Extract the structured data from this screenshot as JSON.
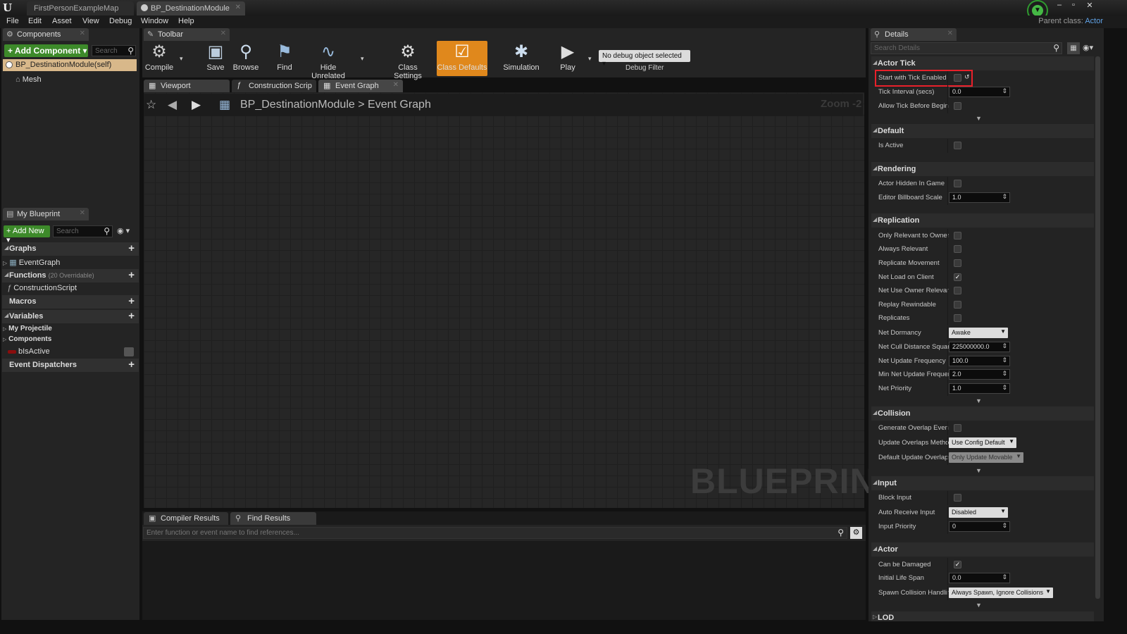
{
  "titlebar": {
    "tabs": [
      "FirstPersonExampleMap",
      "BP_DestinationModule"
    ],
    "window_buttons": [
      "‒",
      "▫",
      "✕"
    ]
  },
  "menubar": {
    "items": [
      "File",
      "Edit",
      "Asset",
      "View",
      "Debug",
      "Window",
      "Help"
    ],
    "parent_class_label": "Parent class:",
    "parent_class_value": "Actor"
  },
  "components": {
    "tab_label": "Components",
    "add_button": "+ Add Component ▾",
    "search_placeholder": "Search",
    "items": [
      "BP_DestinationModule(self)",
      "Mesh"
    ]
  },
  "my_blueprint": {
    "tab_label": "My Blueprint",
    "add_button": "+ Add New ▾",
    "search_placeholder": "Search",
    "graphs_label": "Graphs",
    "event_graph": "EventGraph",
    "functions_label": "Functions",
    "functions_count": "(20 Overridable)",
    "construction_script": "ConstructionScript",
    "macros_label": "Macros",
    "variables_label": "Variables",
    "var_groups": [
      "My Projectile",
      "Components"
    ],
    "var_item": "bIsActive",
    "event_dispatchers_label": "Event Dispatchers"
  },
  "toolbar": {
    "tab_label": "Toolbar",
    "buttons": {
      "compile": "Compile",
      "save": "Save",
      "browse": "Browse",
      "find": "Find",
      "hide_unrelated": "Hide Unrelated",
      "class_settings": "Class Settings",
      "class_defaults": "Class Defaults",
      "simulation": "Simulation",
      "play": "Play"
    },
    "debug_select": "No debug object selected ▾",
    "debug_filter_label": "Debug Filter"
  },
  "graph_tabs": [
    "Viewport",
    "Construction Scrip",
    "Event Graph"
  ],
  "graph": {
    "breadcrumb_root": "BP_DestinationModule",
    "breadcrumb_sep": ">",
    "breadcrumb_leaf": "Event Graph",
    "zoom": "Zoom -2",
    "watermark": "BLUEPRINT"
  },
  "bottom": {
    "tabs": [
      "Compiler Results",
      "Find Results"
    ],
    "find_placeholder": "Enter function or event name to find references..."
  },
  "details": {
    "tab_label": "Details",
    "search_placeholder": "Search Details",
    "sections": {
      "actor_tick": "Actor Tick",
      "default": "Default",
      "rendering": "Rendering",
      "replication": "Replication",
      "collision": "Collision",
      "input": "Input",
      "actor": "Actor",
      "lod": "LOD"
    },
    "props": {
      "start_tick": {
        "label": "Start with Tick Enabled",
        "checked": false
      },
      "tick_interval": {
        "label": "Tick Interval (secs)",
        "value": "0.0"
      },
      "allow_tick": {
        "label": "Allow Tick Before Begin",
        "checked": false
      },
      "is_active": {
        "label": "Is Active",
        "checked": false
      },
      "hidden": {
        "label": "Actor Hidden In Game",
        "checked": false
      },
      "billboard": {
        "label": "Editor Billboard Scale",
        "value": "1.0"
      },
      "only_relevant": {
        "label": "Only Relevant to Owner",
        "checked": false
      },
      "always_relevant": {
        "label": "Always Relevant",
        "checked": false
      },
      "replicate_movement": {
        "label": "Replicate Movement",
        "checked": false
      },
      "net_load": {
        "label": "Net Load on Client",
        "checked": true
      },
      "net_use_owner": {
        "label": "Net Use Owner Relevanc",
        "checked": false
      },
      "replay_rewindable": {
        "label": "Replay Rewindable",
        "checked": false
      },
      "replicates": {
        "label": "Replicates",
        "checked": false
      },
      "net_dormancy": {
        "label": "Net Dormancy",
        "value": "Awake"
      },
      "net_cull": {
        "label": "Net Cull Distance Squar",
        "value": "225000000.0"
      },
      "net_update_freq": {
        "label": "Net Update Frequency",
        "value": "100.0"
      },
      "min_net_update": {
        "label": "Min Net Update Frequen",
        "value": "2.0"
      },
      "net_priority": {
        "label": "Net Priority",
        "value": "1.0"
      },
      "gen_overlap": {
        "label": "Generate Overlap Events",
        "checked": false
      },
      "update_overlaps": {
        "label": "Update Overlaps Methoc",
        "value": "Use Config Default"
      },
      "default_update_overlaps": {
        "label": "Default Update Overlaps",
        "value": "Only Update Movable"
      },
      "block_input": {
        "label": "Block Input",
        "checked": false
      },
      "auto_receive": {
        "label": "Auto Receive Input",
        "value": "Disabled"
      },
      "input_priority": {
        "label": "Input Priority",
        "value": "0"
      },
      "can_be_damaged": {
        "label": "Can be Damaged",
        "checked": true
      },
      "life_span": {
        "label": "Initial Life Span",
        "value": "0.0"
      },
      "spawn_collision": {
        "label": "Spawn Collision Handlin",
        "value": "Always Spawn, Ignore Collisions"
      }
    }
  },
  "colors": {
    "accent_orange": "#e0881c",
    "highlight_red": "#e8202a",
    "add_green": "#3d8a2a",
    "link_blue": "#61a3e6"
  }
}
